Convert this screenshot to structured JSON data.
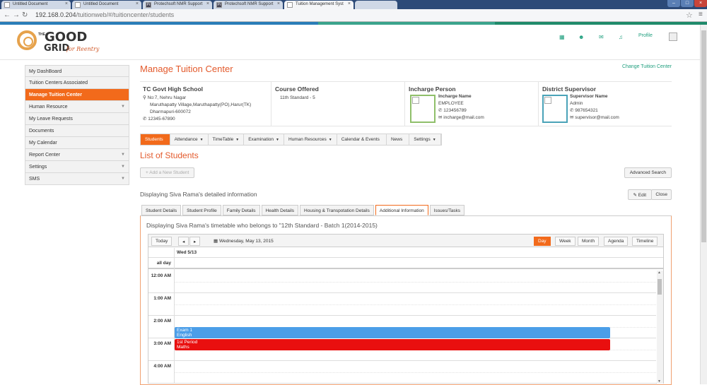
{
  "browser": {
    "tabs": [
      {
        "title": "Untitled Document",
        "icon": "page-icon"
      },
      {
        "title": "Untitled Document",
        "icon": "page-icon"
      },
      {
        "title": "Protechsoft NMR Support",
        "icon": "pt-icon"
      },
      {
        "title": "Protechsoft NMR Support",
        "icon": "pt-icon"
      },
      {
        "title": "Tuition Management Syst",
        "icon": "page-icon"
      },
      {
        "title": "",
        "icon": ""
      }
    ],
    "url_host": "192.168.0.204",
    "url_path": "/tuitionweb/#/tuitioncenter/students"
  },
  "header": {
    "logo_the": "THE",
    "logo_good": "GOOD",
    "logo_grid": "GRID",
    "logo_tag": "for Reentry",
    "profile_label": "Profile"
  },
  "sidebar": {
    "items": [
      {
        "label": "My DashBoard",
        "arrow": ""
      },
      {
        "label": "Tuition Centers Associated",
        "arrow": ""
      },
      {
        "label": "Manage Tuition Center",
        "arrow": "",
        "active": true
      },
      {
        "label": "Human Resource",
        "arrow": "▼"
      },
      {
        "label": "My Leave Requests",
        "arrow": ""
      },
      {
        "label": "Documents",
        "arrow": ""
      },
      {
        "label": "My Calendar",
        "arrow": ""
      },
      {
        "label": "Report Center",
        "arrow": "▼"
      },
      {
        "label": "Settings",
        "arrow": "▼"
      },
      {
        "label": "SMS",
        "arrow": "▼"
      }
    ]
  },
  "main": {
    "title": "Manage Tuition Center",
    "change_link": "Change Tuition Center",
    "school": {
      "name": "TC Govt High School",
      "addr1": "No:7, Nehru Nagar",
      "addr2": "Maruthapatty Village,Maruthapatty(PO),Harur(TK)",
      "addr3": "Dharmapuri-600072",
      "phone": "12345-67890"
    },
    "course": {
      "heading": "Course Offered",
      "value": "11th Standard - 5"
    },
    "incharge": {
      "heading": "Incharge Person",
      "name": "Incharge Name",
      "role": "EMPLOYEE",
      "phone": "123456789",
      "email": "incharge@mail.com"
    },
    "supervisor": {
      "heading": "District Supervisor",
      "name": "Supervisor Name",
      "role": "Admin",
      "phone": "987654321",
      "email": "supervisor@mail.com"
    },
    "module_tabs": [
      {
        "label": "Students",
        "caret": ""
      },
      {
        "label": "Attendance",
        "caret": "▼"
      },
      {
        "label": "TimeTable",
        "caret": "▼"
      },
      {
        "label": "Examination",
        "caret": "▼"
      },
      {
        "label": "Human Resources",
        "caret": "▼"
      },
      {
        "label": "Calendar & Events",
        "caret": ""
      },
      {
        "label": "News",
        "caret": ""
      },
      {
        "label": "Settings",
        "caret": "▼"
      }
    ],
    "list_title": "List of Students",
    "add_button": "+ Add a New Student",
    "advanced_search": "Advanced Search",
    "displaying": "Displaying Siva Rama's detailed information",
    "edit_button": "✎ Edit",
    "close_button": "Close",
    "detail_tabs": [
      "Student Details",
      "Student Profile",
      "Family Details",
      "Health Details",
      "Housing & Transpotation Details",
      "Additional Information",
      "Issues/Tasks"
    ],
    "active_detail_tab": "Additional Information",
    "timetable_title": "Displaying Siva Rama's timetable who belongs to \"12th Standard - Batch 1(2014-2015)",
    "calendar": {
      "today": "Today",
      "prev": "◂",
      "next": "▸",
      "date": "Wednesday, May 13, 2015",
      "views": [
        "Day",
        "Week",
        "Month",
        "Agenda",
        "Timeline"
      ],
      "active_view": "Day",
      "col_header": "Wed 5/13",
      "allday": "all day",
      "hours": [
        "12:00 AM",
        "1:00 AM",
        "2:00 AM",
        "3:00 AM",
        "4:00 AM"
      ],
      "events": [
        {
          "line1": "Exam 1",
          "line2": "English",
          "color": "#4b9ee8"
        },
        {
          "line1": "1st Period",
          "line2": "Maths",
          "color": "#e90f0f"
        }
      ]
    }
  },
  "colors": {
    "accent": "#f26a1b",
    "title": "#e35a2c",
    "teal": "#1e9e7d"
  }
}
